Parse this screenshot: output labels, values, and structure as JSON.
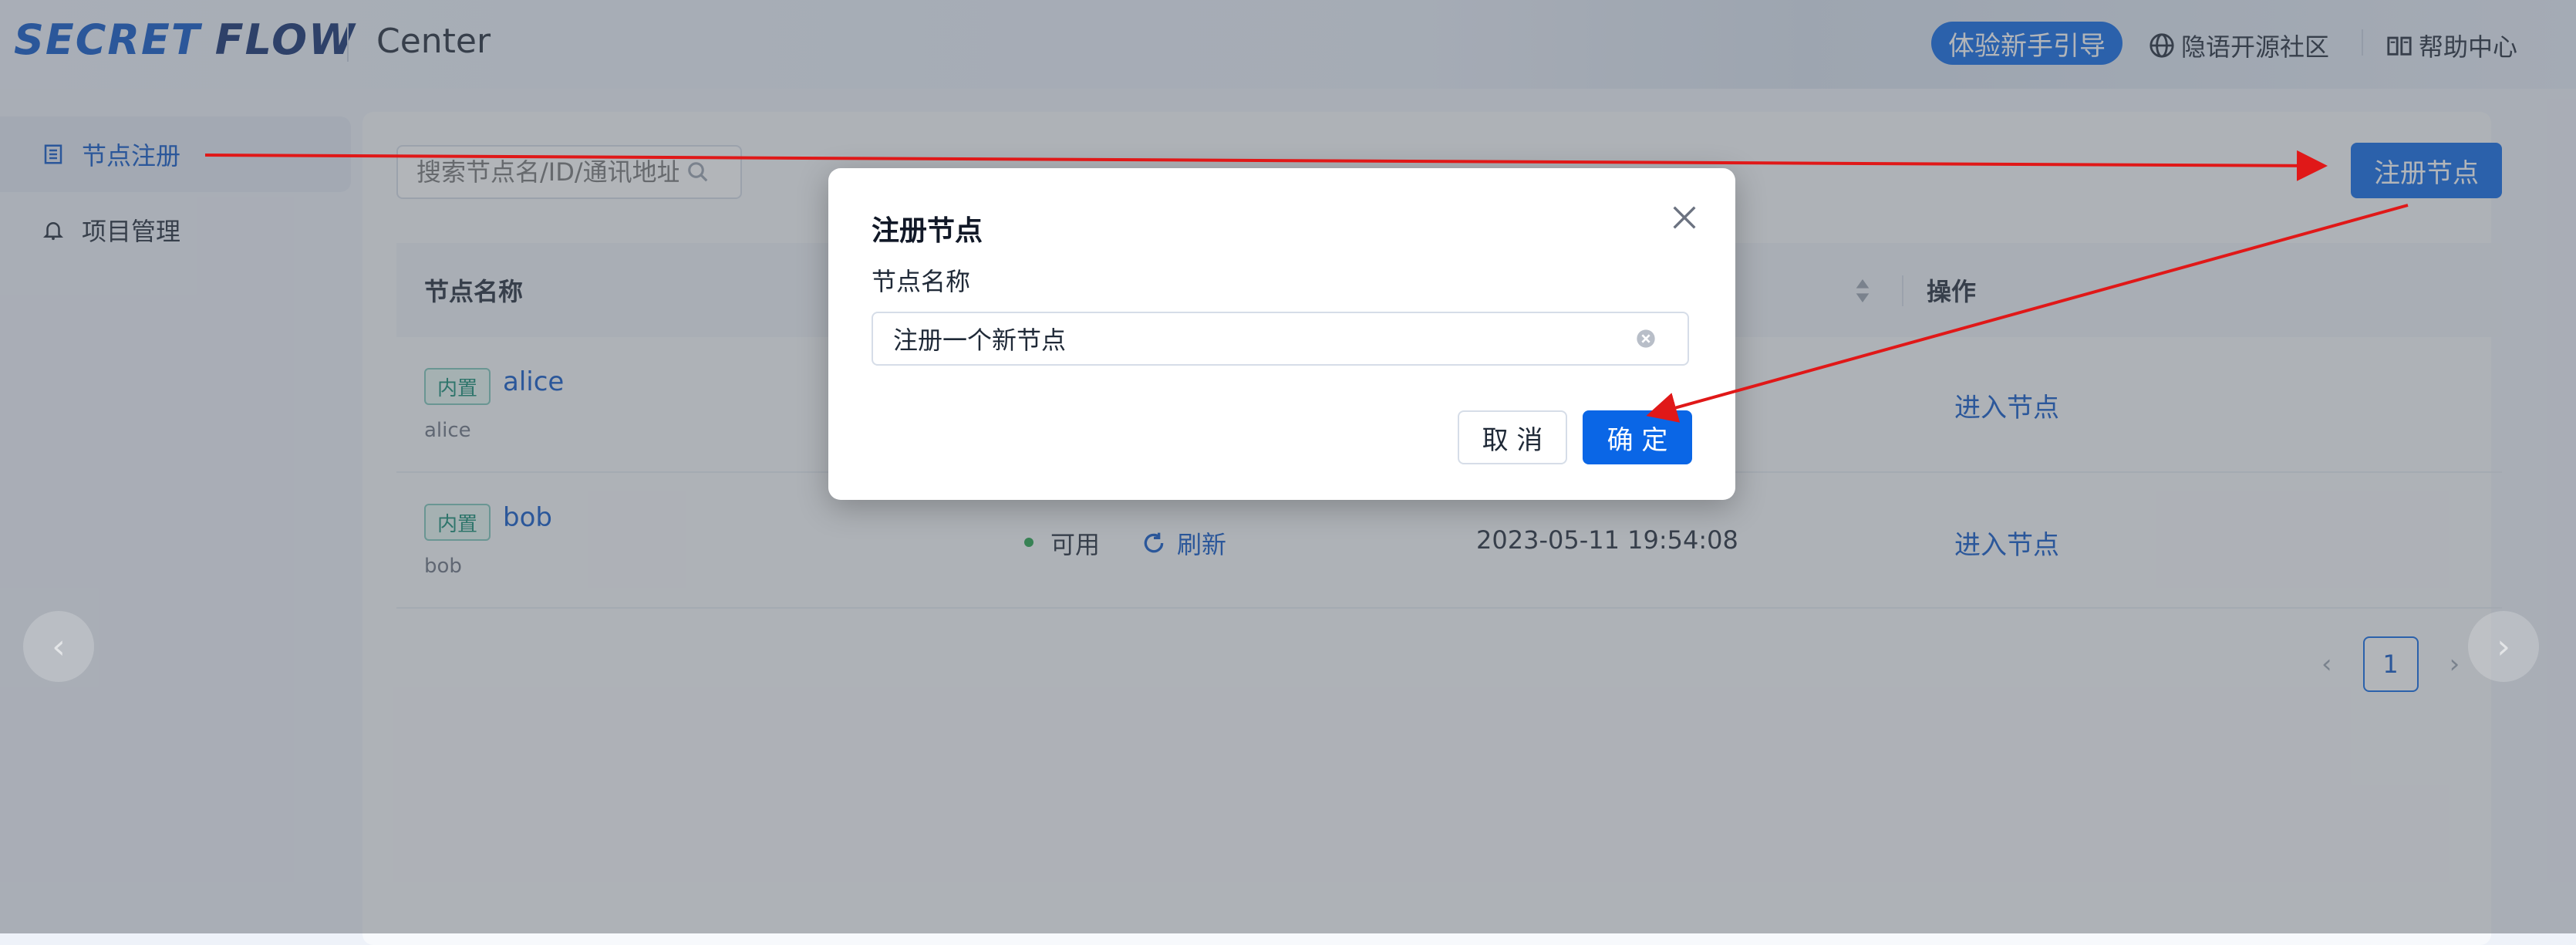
{
  "header": {
    "logo_part1": "SECRET",
    "logo_part2": "FLOW",
    "title": "Center",
    "guide_button": "体验新手引导",
    "community_link": "隐语开源社区",
    "help_link": "帮助中心"
  },
  "sidebar": {
    "items": [
      {
        "label": "节点注册",
        "icon": "table-icon",
        "active": true
      },
      {
        "label": "项目管理",
        "icon": "bell-icon",
        "active": false
      }
    ]
  },
  "main": {
    "search_placeholder": "搜索节点名/ID/通讯地址",
    "register_button": "注册节点",
    "columns": [
      "节点名称",
      "操作"
    ],
    "rows": [
      {
        "tag": "内置",
        "name": "alice",
        "id": "alice",
        "status": "",
        "refresh": "",
        "time": "",
        "action": "进入节点"
      },
      {
        "tag": "内置",
        "name": "bob",
        "id": "bob",
        "status": "可用",
        "refresh": "刷新",
        "time": "2023-05-11 19:54:08",
        "action": "进入节点"
      }
    ],
    "pagination": {
      "current": "1"
    }
  },
  "modal": {
    "title": "注册节点",
    "field_label": "节点名称",
    "field_value": "注册一个新节点",
    "cancel": "取 消",
    "ok": "确 定"
  },
  "colors": {
    "primary": "#0a66e6",
    "annotation_arrow": "#e01818",
    "status_ok": "#22a34a"
  }
}
